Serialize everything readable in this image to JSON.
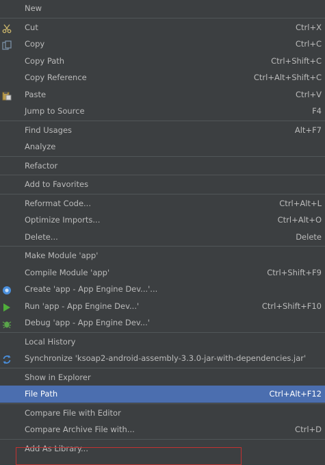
{
  "menu": {
    "items": [
      {
        "label": "New",
        "shortcut": "",
        "icon": ""
      },
      {
        "sep": true
      },
      {
        "label": "Cut",
        "shortcut": "Ctrl+X",
        "icon": "scissors-icon",
        "color": "#c8b36a"
      },
      {
        "label": "Copy",
        "shortcut": "Ctrl+C",
        "icon": "copy-icon",
        "color": "#7a8fa6"
      },
      {
        "label": "Copy Path",
        "shortcut": "Ctrl+Shift+C",
        "icon": ""
      },
      {
        "label": "Copy Reference",
        "shortcut": "Ctrl+Alt+Shift+C",
        "icon": ""
      },
      {
        "label": "Paste",
        "shortcut": "Ctrl+V",
        "icon": "paste-icon",
        "color": "#b89b4f"
      },
      {
        "label": "Jump to Source",
        "shortcut": "F4",
        "icon": ""
      },
      {
        "sep": true
      },
      {
        "label": "Find Usages",
        "shortcut": "Alt+F7",
        "icon": ""
      },
      {
        "label": "Analyze",
        "shortcut": "",
        "icon": ""
      },
      {
        "sep": true
      },
      {
        "label": "Refactor",
        "shortcut": "",
        "icon": ""
      },
      {
        "sep": true
      },
      {
        "label": "Add to Favorites",
        "shortcut": "",
        "icon": ""
      },
      {
        "sep": true
      },
      {
        "label": "Reformat Code...",
        "shortcut": "Ctrl+Alt+L",
        "icon": ""
      },
      {
        "label": "Optimize Imports...",
        "shortcut": "Ctrl+Alt+O",
        "icon": ""
      },
      {
        "label": "Delete...",
        "shortcut": "Delete",
        "icon": ""
      },
      {
        "sep": true
      },
      {
        "label": "Make Module 'app'",
        "shortcut": "",
        "icon": ""
      },
      {
        "label": "Compile Module 'app'",
        "shortcut": "Ctrl+Shift+F9",
        "icon": ""
      },
      {
        "label": "Create 'app - App Engine Dev...'...",
        "shortcut": "",
        "icon": "app-engine-icon",
        "color": "#4a8fdc"
      },
      {
        "label": "Run 'app - App Engine Dev...'",
        "shortcut": "Ctrl+Shift+F10",
        "icon": "run-icon",
        "color": "#4fae3a"
      },
      {
        "label": "Debug 'app - App Engine Dev...'",
        "shortcut": "",
        "icon": "debug-icon",
        "color": "#5aa54a"
      },
      {
        "sep": true
      },
      {
        "label": "Local History",
        "shortcut": "",
        "icon": ""
      },
      {
        "label": "Synchronize 'ksoap2-android-assembly-3.3.0-jar-with-dependencies.jar'",
        "shortcut": "",
        "icon": "sync-icon",
        "color": "#4a8fdc"
      },
      {
        "sep": true
      },
      {
        "label": "Show in Explorer",
        "shortcut": "",
        "icon": ""
      },
      {
        "label": "File Path",
        "shortcut": "Ctrl+Alt+F12",
        "icon": "",
        "selected": true
      },
      {
        "sep": true
      },
      {
        "label": "Compare File with Editor",
        "shortcut": "",
        "icon": ""
      },
      {
        "label": "Compare Archive File with...",
        "shortcut": "Ctrl+D",
        "icon": ""
      },
      {
        "sep": true
      },
      {
        "label": "Add As Library...",
        "shortcut": "",
        "icon": ""
      }
    ]
  }
}
